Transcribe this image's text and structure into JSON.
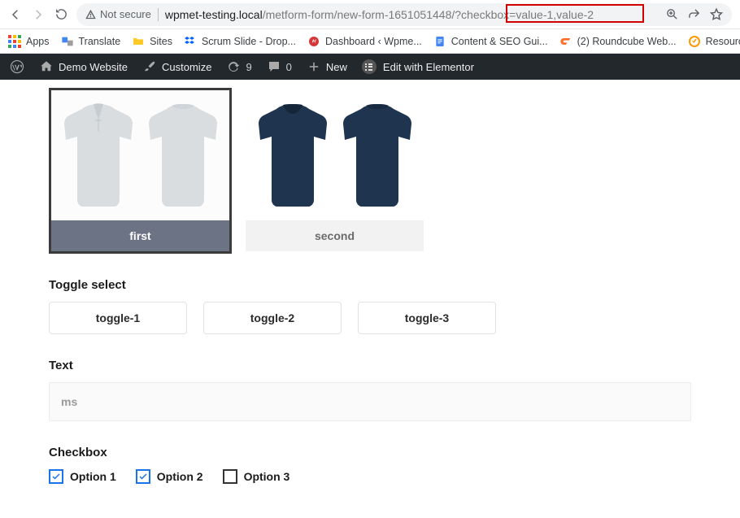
{
  "browser": {
    "not_secure": "Not secure",
    "url_host": "wpmet-testing.local",
    "url_path": "/metform-form/new-form-1651051448/?checkbox=value-1,value-2",
    "highlight_style": "left:528px; top:1px; width:170px; height:23px;"
  },
  "bookmarks": {
    "apps": "Apps",
    "translate": "Translate",
    "sites": "Sites",
    "scrum": "Scrum Slide - Drop...",
    "dashboard": "Dashboard ‹ Wpme...",
    "seo": "Content & SEO Gui...",
    "roundcube": "(2) Roundcube Web...",
    "resource": "Resource"
  },
  "wpbar": {
    "site_name": "Demo Website",
    "customize": "Customize",
    "updates_count": "9",
    "comments_count": "0",
    "new": "New",
    "elementor": "Edit with Elementor"
  },
  "form": {
    "image_options": {
      "first": "first",
      "second": "second"
    },
    "toggle_label": "Toggle select",
    "toggles": {
      "t1": "toggle-1",
      "t2": "toggle-2",
      "t3": "toggle-3"
    },
    "text_label": "Text",
    "text_value": "ms",
    "checkbox_label": "Checkbox",
    "checkbox": {
      "o1": "Option 1",
      "o2": "Option 2",
      "o3": "Option 3"
    }
  }
}
